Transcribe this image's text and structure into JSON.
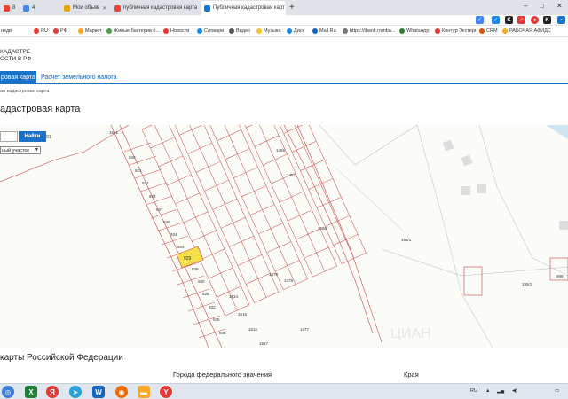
{
  "browser": {
    "tabs": [
      {
        "label": "8"
      },
      {
        "label": "4"
      },
      {
        "label": "Мои объяв"
      },
      {
        "label": "публичная кадастровая карта"
      },
      {
        "label": "Публичная кадастровая карт"
      }
    ],
    "new_tab": "+",
    "window_controls": [
      "–",
      "□",
      "✕"
    ]
  },
  "bookmarks": [
    {
      "label": "недв"
    },
    {
      "label": "RU"
    },
    {
      "label": "РФ"
    },
    {
      "label": "Маркет"
    },
    {
      "label": "Живые бактерии б..."
    },
    {
      "label": "Новости"
    },
    {
      "label": "Словари"
    },
    {
      "label": "Видео"
    },
    {
      "label": "Музыка"
    },
    {
      "label": "Диск"
    },
    {
      "label": "Mail.Ru"
    },
    {
      "label": "https://ibank.rnmba..."
    },
    {
      "label": "WhatsApp"
    },
    {
      "label": "Контур Экстерн"
    },
    {
      "label": "CRM"
    },
    {
      "label": "РАБОЧАЯ АФИДС"
    }
  ],
  "header": {
    "site_title_line1": "КАДАСТРЕ",
    "site_title_line2": "ОСТИ В РФ"
  },
  "nav": {
    "active_tab": "ровая карта",
    "tab2": "Расчет земельного налога"
  },
  "breadcrumb": "ая кадастровая карта",
  "page_title": "адастровая карта",
  "map": {
    "search_button": "Найти",
    "search_value": "",
    "layer_select": "ный участок",
    "zoom_label": "91",
    "parcel_numbers": [
      "1591",
      "920",
      "921",
      "922",
      "923",
      "927",
      "925",
      "924",
      "929",
      "939",
      "930",
      "928",
      "932",
      "935",
      "936",
      "1456",
      "1457",
      "1566",
      "1614",
      "1615",
      "1616",
      "1617",
      "195/1",
      "195/1",
      "999",
      "1479",
      "1478",
      "1477"
    ],
    "highlighted_parcel": "929",
    "watermark": "ЦИАН"
  },
  "section": {
    "title": "карты Российской Федерации",
    "col1": "Города федерального значения",
    "col2": "Края"
  },
  "taskbar": {
    "lang": "RU",
    "tray_icons": [
      "up-arrow-icon",
      "network-icon",
      "volume-icon"
    ]
  }
}
